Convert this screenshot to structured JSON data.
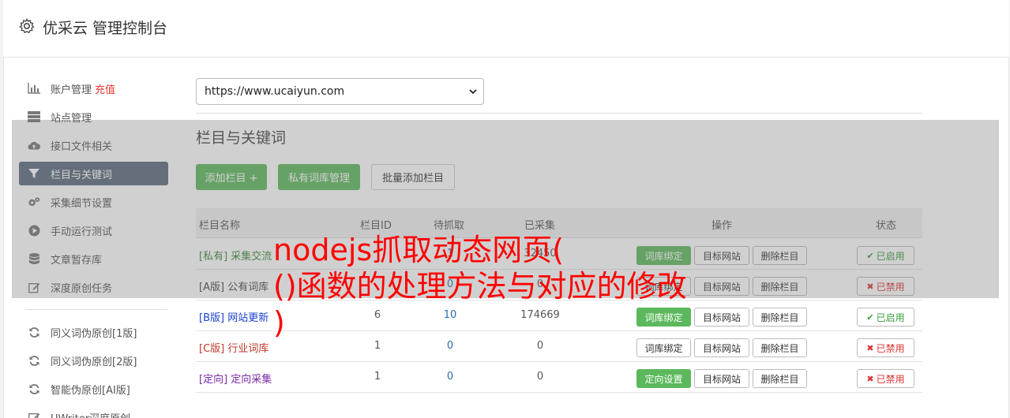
{
  "header": {
    "title": "优采云 管理控制台",
    "icon": "gear-icon"
  },
  "sidebar": {
    "items": [
      {
        "label": "账户管理",
        "extra": "充值",
        "icon": "bar-chart-icon"
      },
      {
        "label": "站点管理",
        "icon": "server-icon"
      },
      {
        "label": "接口文件相关",
        "icon": "cloud-upload-icon"
      },
      {
        "label": "栏目与关键词",
        "icon": "filter-icon"
      },
      {
        "label": "采集细节设置",
        "icon": "cogs-icon"
      },
      {
        "label": "手动运行测试",
        "icon": "play-circle-icon"
      },
      {
        "label": "文章暂存库",
        "icon": "database-icon"
      },
      {
        "label": "深度原创任务",
        "icon": "edit-icon"
      },
      {
        "label": "同义词伪原创[1版]",
        "icon": "refresh-icon"
      },
      {
        "label": "同义词伪原创[2版]",
        "icon": "refresh-icon"
      },
      {
        "label": "智能伪原创[AI版]",
        "icon": "refresh-icon"
      },
      {
        "label": "UWriter深度原创",
        "icon": "edit-icon"
      }
    ]
  },
  "site_select": {
    "value": "https://www.ucaiyun.com"
  },
  "section": {
    "title": "栏目与关键词"
  },
  "actions": {
    "add": "添加栏目 +",
    "private": "私有词库管理",
    "bulk": "批量添加栏目"
  },
  "table": {
    "headers": {
      "name": "栏目名称",
      "id": "栏目ID",
      "pending": "待抓取",
      "collected": "已采集",
      "ops": "操作",
      "status": "状态"
    },
    "rows": [
      {
        "tag": "[私有]",
        "name": "采集交流",
        "id": "",
        "pending": "1",
        "collected": "32450",
        "op1": "词库绑定",
        "op2": "目标网站",
        "op3": "删除栏目",
        "status": "已启用",
        "color": "#3a8a3a"
      },
      {
        "tag": "[A版]",
        "name": "公有词库",
        "id": "",
        "pending": "0",
        "collected": "0",
        "op1": "词库绑定",
        "op2": "目标网站",
        "op3": "删除栏目",
        "status": "已禁用",
        "color": "#444444"
      },
      {
        "tag": "[B版]",
        "name": "网站更新",
        "id": "6",
        "pending": "10",
        "collected": "174669",
        "op1": "词库绑定",
        "op2": "目标网站",
        "op3": "删除栏目",
        "status": "已启用",
        "color": "#1a3fd0"
      },
      {
        "tag": "[C版]",
        "name": "行业词库",
        "id": "1",
        "pending": "0",
        "collected": "0",
        "op1": "词库绑定",
        "op2": "目标网站",
        "op3": "删除栏目",
        "status": "已禁用",
        "color": "#c0392b"
      },
      {
        "tag": "[定向]",
        "name": "定向采集",
        "id": "1",
        "pending": "0",
        "collected": "0",
        "op1": "定向设置",
        "op2": "目标网站",
        "op3": "删除栏目",
        "status": "已禁用",
        "color": "#7b2aa8"
      }
    ]
  },
  "watermark": {
    "line1": "nodejs抓取动态网页(",
    "line2": "()函数的处理方法与对应的修改",
    "line3": ")"
  }
}
